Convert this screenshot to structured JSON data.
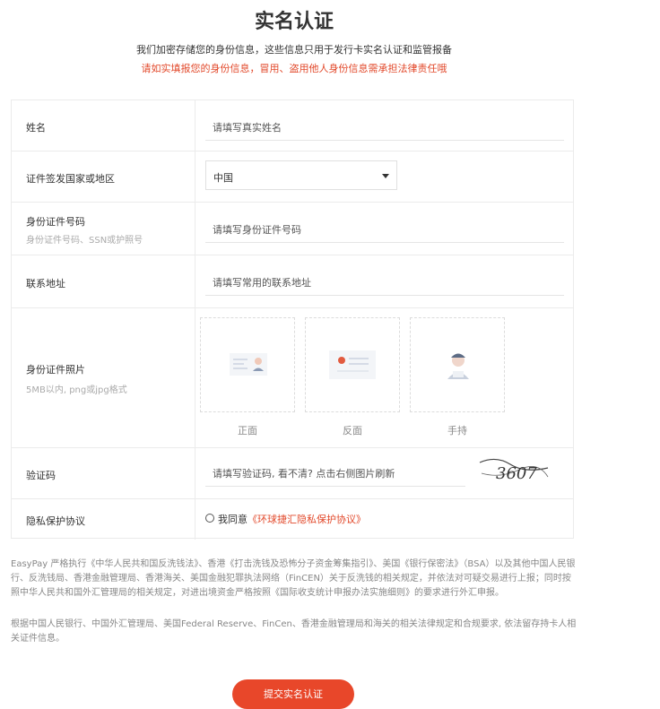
{
  "header": {
    "title": "实名认证",
    "subtitle": "我们加密存储您的身份信息，这些信息只用于发行卡实名认证和监管报备",
    "warning": "请如实填报您的身份信息，冒用、盗用他人身份信息需承担法律责任哦"
  },
  "form": {
    "name": {
      "label": "姓名",
      "placeholder": "请填写真实姓名"
    },
    "country": {
      "label": "证件签发国家或地区",
      "value": "中国"
    },
    "id_number": {
      "label": "身份证件号码",
      "hint": "身份证件号码、SSN或护照号",
      "placeholder": "请填写身份证件号码"
    },
    "address": {
      "label": "联系地址",
      "placeholder": "请填写常用的联系地址"
    },
    "id_photo": {
      "label": "身份证件照片",
      "hint": "5MB以内, png或jpg格式",
      "front": "正面",
      "back": "反面",
      "handheld": "手持"
    },
    "captcha": {
      "label": "验证码",
      "placeholder": "请填写验证码, 看不清? 点击右侧图片刷新",
      "code": "3607"
    },
    "privacy": {
      "label": "隐私保护协议",
      "agree": "我同意",
      "link": "《环球捷汇隐私保护协议》"
    }
  },
  "notes": {
    "para1": "EasyPay 严格执行《中华人民共和国反洗钱法》、香港《打击洗钱及恐怖分子资金筹集指引》、美国《银行保密法》（BSA）以及其他中国人民银行、反洗钱局、香港金融管理局、香港海关、美国金融犯罪执法网络（FinCEN）关于反洗钱的相关规定，并依法对可疑交易进行上报；同时按照中华人民共和国外汇管理局的相关规定，对进出境资金严格按照《国际收支统计申报办法实施细则》的要求进行外汇申报。",
    "para2": "根据中国人民银行、中国外汇管理局、美国Federal Reserve、FinCen、香港金融管理局和海关的相关法律规定和合规要求, 依法留存持卡人相关证件信息。"
  },
  "submit_label": "提交实名认证",
  "colors": {
    "accent": "#e8472a",
    "warning_text": "#e2492b"
  }
}
